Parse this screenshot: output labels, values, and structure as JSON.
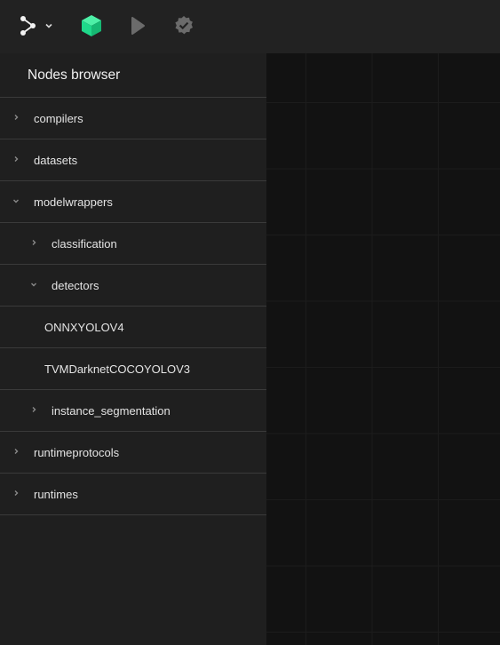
{
  "toolbar": {
    "graph_menu_icon": "graph-nodes-icon",
    "dropdown_icon": "chevron-down-icon",
    "nodes_icon": "cube-icon",
    "run_icon": "play-icon",
    "validate_icon": "badge-check-icon",
    "accent_color": "#1fd98b",
    "muted_color": "#6b6b6b"
  },
  "sidebar": {
    "title": "Nodes browser",
    "items": [
      {
        "label": "compilers",
        "level": 0,
        "expanded": false,
        "has_children": true
      },
      {
        "label": "datasets",
        "level": 0,
        "expanded": false,
        "has_children": true
      },
      {
        "label": "modelwrappers",
        "level": 0,
        "expanded": true,
        "has_children": true
      },
      {
        "label": "classification",
        "level": 1,
        "expanded": false,
        "has_children": true
      },
      {
        "label": "detectors",
        "level": 1,
        "expanded": true,
        "has_children": true
      },
      {
        "label": "ONNXYOLOV4",
        "level": 2,
        "expanded": false,
        "has_children": false
      },
      {
        "label": "TVMDarknetCOCOYOLOV3",
        "level": 2,
        "expanded": false,
        "has_children": false
      },
      {
        "label": "instance_segmentation",
        "level": 1,
        "expanded": false,
        "has_children": true
      },
      {
        "label": "runtimeprotocols",
        "level": 0,
        "expanded": false,
        "has_children": true
      },
      {
        "label": "runtimes",
        "level": 0,
        "expanded": false,
        "has_children": true
      }
    ]
  }
}
